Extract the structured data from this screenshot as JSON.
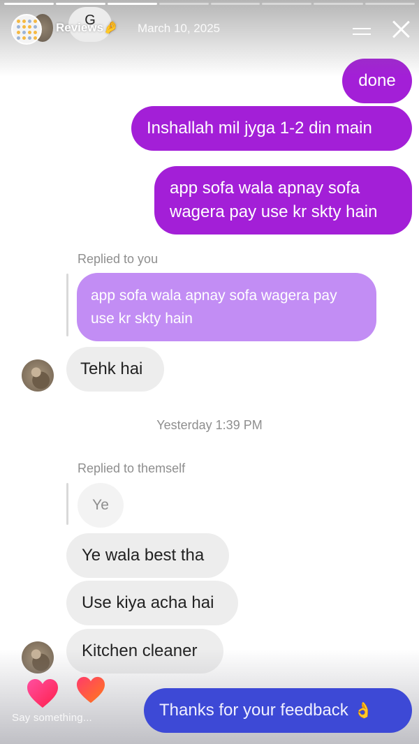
{
  "story": {
    "title": "Reviews",
    "title_emoji": "🤌",
    "date": "March 10, 2025",
    "progress": {
      "segments": 8,
      "completed": 3
    }
  },
  "chat": {
    "hidden_top_letter": "G",
    "sent_messages": [
      "done",
      "Inshallah mil jyga 1-2 din main",
      "app sofa wala apnay sofa wagera pay use kr skty hain"
    ],
    "reply_block_1": {
      "label": "Replied to you",
      "quoted": "app sofa wala apnay sofa wagera pay use kr skty hain",
      "reply": "Tehk hai"
    },
    "timestamp": "Yesterday 1:39 PM",
    "reply_block_2": {
      "label": "Replied to themself",
      "quoted": "Ye",
      "messages": [
        "Ye wala best tha",
        "Use kiya acha hai",
        "Kitchen cleaner"
      ]
    }
  },
  "footer": {
    "placeholder": "Say something...",
    "feedback_text": "Thanks for your feedback",
    "feedback_emoji": "👌"
  },
  "colors": {
    "sent_bubble": "#a31fd7",
    "quoted_bubble": "#c28df4",
    "received_bubble": "#ededed",
    "feedback_pill": "#3d49d6",
    "heart_pink": "#ff1f6b",
    "heart_orange": "#ff5a1f"
  }
}
